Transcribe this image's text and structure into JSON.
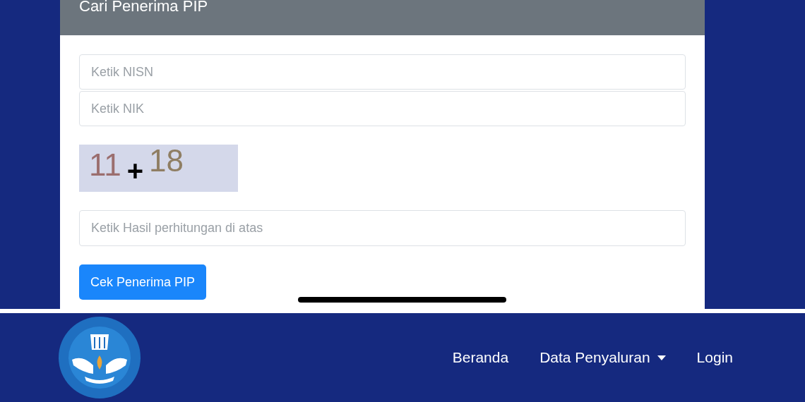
{
  "card": {
    "title": "Cari Penerima PIP",
    "fields": [
      {
        "placeholder": "Ketik NISN"
      },
      {
        "placeholder": "Ketik NIK"
      }
    ],
    "captcha": {
      "first": "11",
      "operator": "+",
      "second": "18"
    },
    "answer_field": {
      "placeholder": "Ketik Hasil perhitungan di atas"
    },
    "submit_button": "Cek Penerima PIP"
  },
  "navbar": {
    "links": [
      {
        "label": "Beranda",
        "kind": "link"
      },
      {
        "label": "Data Penyaluran",
        "kind": "dropdown"
      },
      {
        "label": "Login",
        "kind": "link"
      }
    ]
  }
}
